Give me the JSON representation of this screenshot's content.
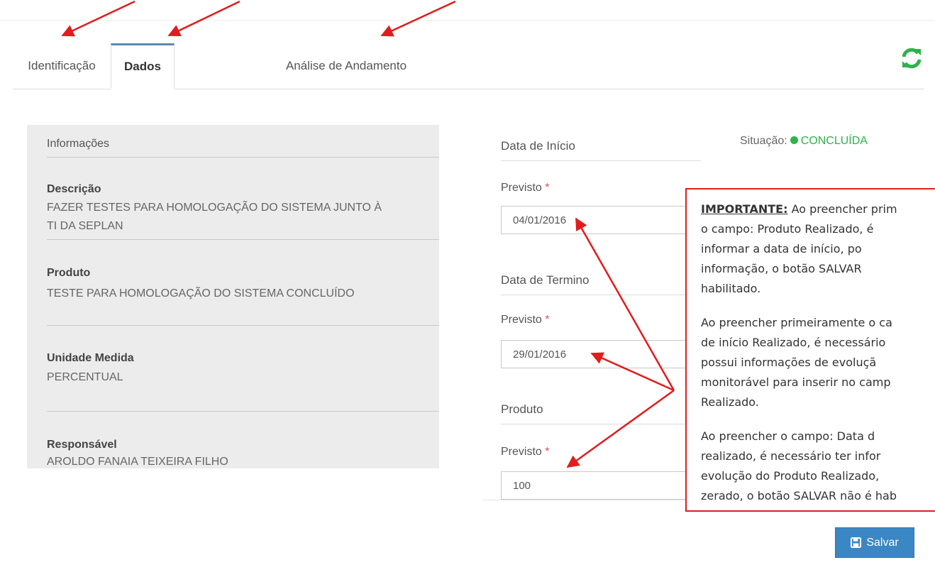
{
  "tabs": [
    {
      "label": "Identificação",
      "active": false
    },
    {
      "label": "Dados",
      "active": true
    },
    {
      "label": "Análise de Andamento",
      "active": false
    }
  ],
  "refresh_icon": "refresh-icon",
  "info": {
    "header": "Informações",
    "description_label": "Descrição",
    "description_value_line1": "FAZER TESTES PARA HOMOLOGAÇÃO DO SISTEMA JUNTO À",
    "description_value_line2": "TI DA SEPLAN",
    "product_label": "Produto",
    "product_value": "TESTE PARA HOMOLOGAÇÃO DO SISTEMA CONCLUÍDO",
    "unit_label": "Unidade Medida",
    "unit_value": "PERCENTUAL",
    "responsible_label": "Responsável",
    "responsible_value": "AROLDO FANAIA TEIXEIRA FILHO"
  },
  "status": {
    "label": "Situação:",
    "value": "CONCLUÍDA",
    "color": "#2eb34a"
  },
  "dates": {
    "start": {
      "title": "Data de Início",
      "planned_label": "Previsto",
      "planned_value": "04/01/2016"
    },
    "end": {
      "title": "Data de Termino",
      "planned_label": "Previsto",
      "planned_value": "29/01/2016"
    },
    "product": {
      "title": "Produto",
      "planned_label": "Previsto",
      "planned_value": "100"
    },
    "required_mark": "*"
  },
  "note": {
    "important": "IMPORTANTE:",
    "p1_l1": " Ao preencher prim",
    "p1_l2": "o campo: Produto Realizado, é",
    "p1_l3": "informar a data de início, po",
    "p1_l4": "informação, o botão SALVAR",
    "p1_l5": "habilitado.",
    "p2_l1": "Ao preencher primeiramente o ca",
    "p2_l2": "de início Realizado, é necessário",
    "p2_l3": "possui informações de evoluçã",
    "p2_l4": "monitorável para inserir no camp",
    "p2_l5": "Realizado.",
    "p3_l1": "Ao preencher o campo: Data d",
    "p3_l2": "realizado, é necessário ter infor",
    "p3_l3": "evolução do Produto Realizado,",
    "p3_l4": "zerado, o botão SALVAR não é hab"
  },
  "save_button": {
    "label": "Salvar",
    "icon": "save-icon"
  },
  "accent_color": "#3b87c3",
  "annotation_color": "#e21c1c"
}
